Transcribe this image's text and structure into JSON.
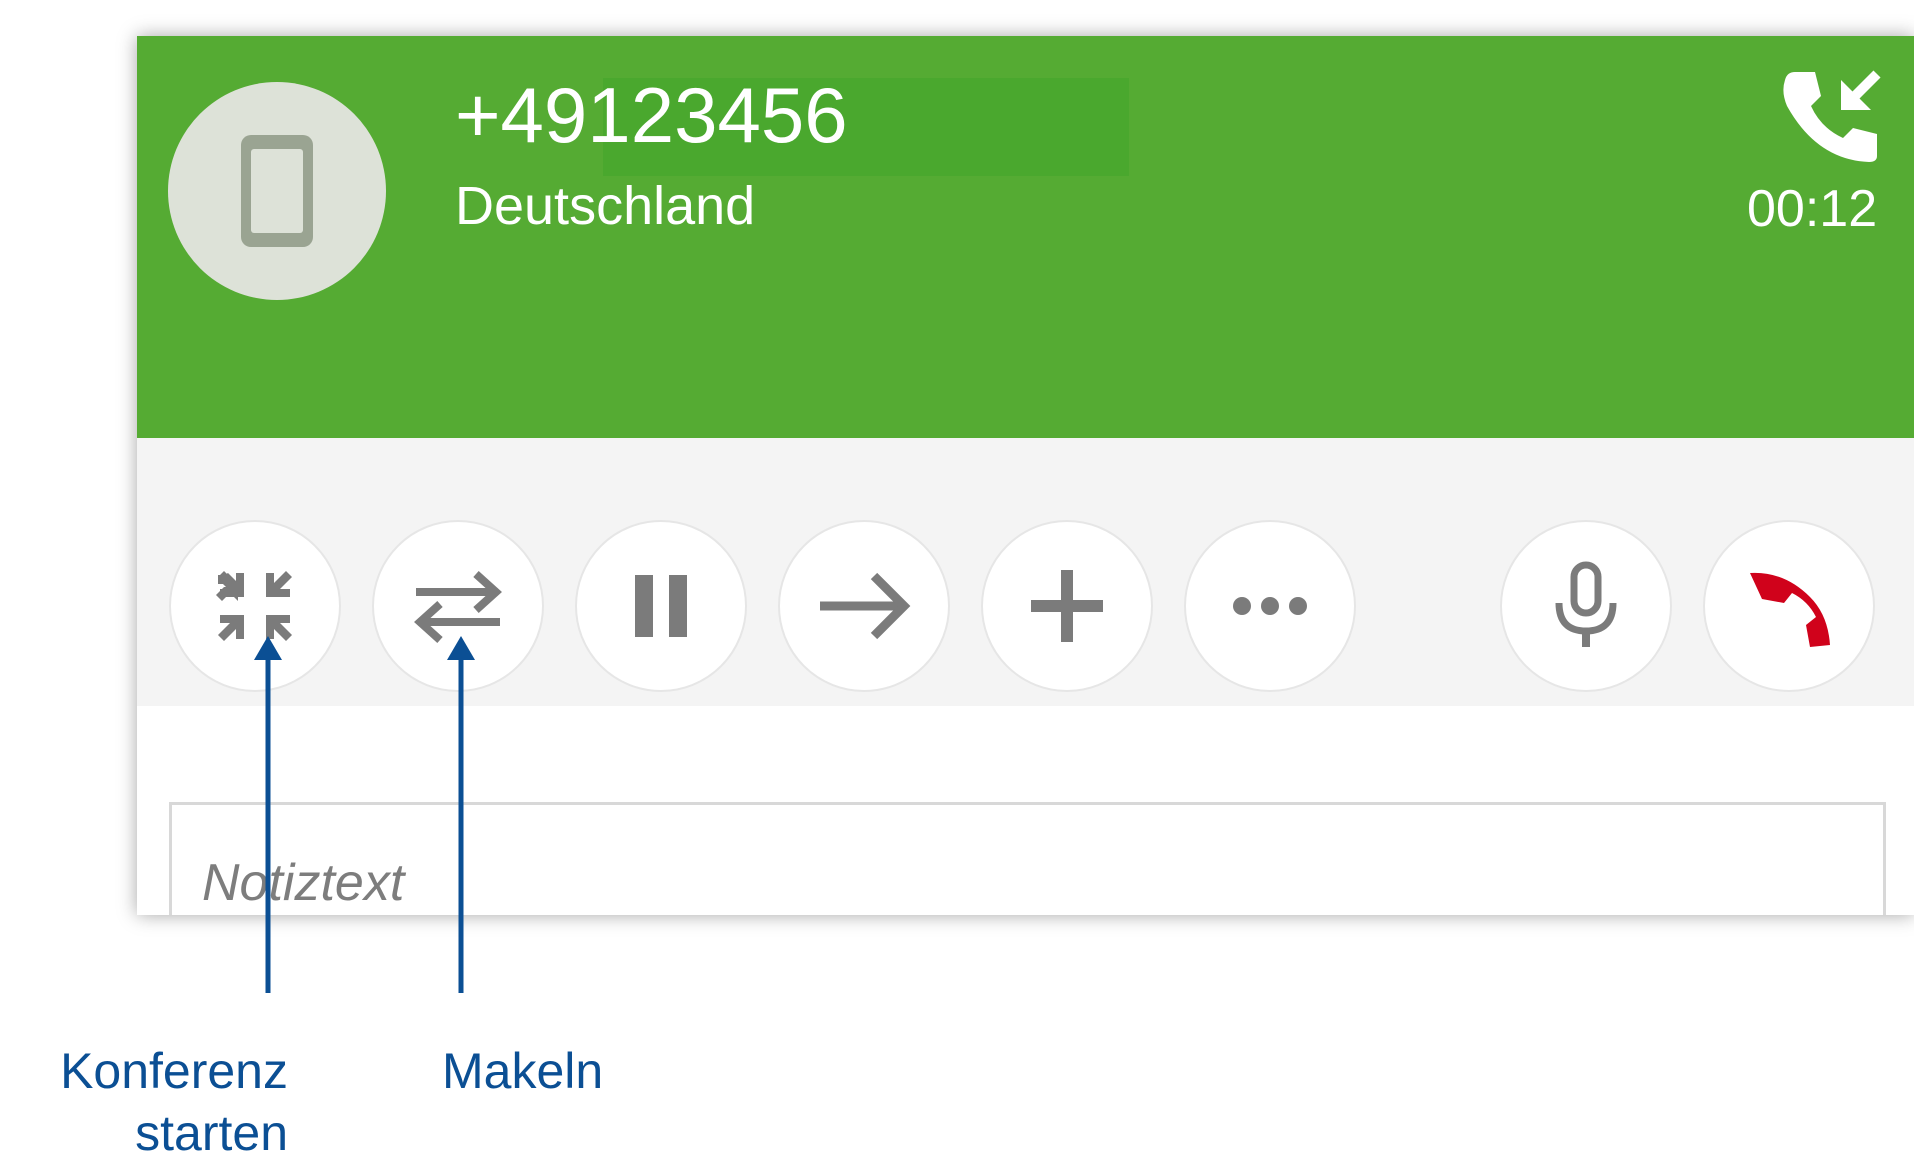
{
  "call": {
    "number": "+49123456",
    "country": "Deutschland",
    "duration": "00:12",
    "direction_icon": "incoming-call-icon"
  },
  "avatar": {
    "icon": "mobile-phone-icon"
  },
  "controls": [
    {
      "name": "conference-button",
      "icon": "merge-calls-icon"
    },
    {
      "name": "swap-calls-button",
      "icon": "swap-arrows-icon"
    },
    {
      "name": "hold-button",
      "icon": "pause-icon"
    },
    {
      "name": "transfer-button",
      "icon": "arrow-right-icon"
    },
    {
      "name": "add-call-button",
      "icon": "plus-icon"
    },
    {
      "name": "more-button",
      "icon": "more-dots-icon"
    },
    {
      "name": "mute-button",
      "icon": "microphone-icon"
    },
    {
      "name": "hang-up-button",
      "icon": "hang-up-icon"
    }
  ],
  "note": {
    "placeholder": "Notiztext",
    "value": ""
  },
  "annotations": {
    "conference_line1": "Konferenz",
    "conference_line2": "starten",
    "swap": "Makeln"
  },
  "colors": {
    "header": "#55ab33",
    "toolbar": "#f4f4f4",
    "icon": "#7b7b7b",
    "hangup": "#d0021b",
    "annotation": "#0b4f94"
  }
}
